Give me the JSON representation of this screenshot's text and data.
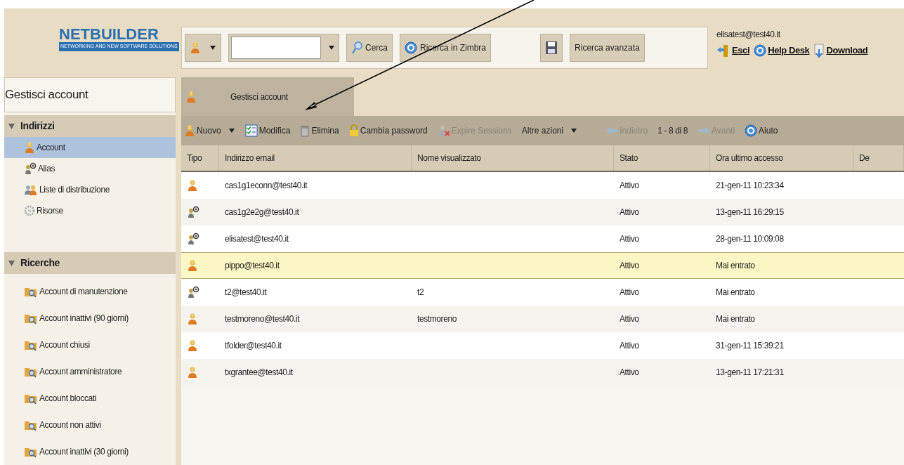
{
  "logo": {
    "name": "NETBUILDER",
    "tagline": "NETWORKING AND NEW SOFTWARE SOLUTIONS"
  },
  "search_bar": {
    "search_button": "Cerca",
    "zimbra_button": "Ricerca in Zimbra",
    "advanced_button": "Ricerca avanzata"
  },
  "user": {
    "email": "elisatest@test40.it",
    "links": [
      {
        "kind": "exit",
        "label": "Esci"
      },
      {
        "kind": "help",
        "label": "Help Desk"
      },
      {
        "kind": "download",
        "label": "Download"
      }
    ]
  },
  "sidebar": {
    "title": "Gestisci account",
    "sections": [
      {
        "label": "Indirizzi",
        "expanded": true,
        "items": [
          {
            "kind": "account",
            "label": "Account",
            "selected": true
          },
          {
            "kind": "alias",
            "label": "Alias",
            "selected": false
          },
          {
            "kind": "list",
            "label": "Liste di distribuzione",
            "selected": false
          },
          {
            "kind": "resource",
            "label": "Risorse",
            "selected": false
          }
        ]
      },
      {
        "label": "Ricerche",
        "expanded": true,
        "items": [
          {
            "kind": "search",
            "label": "Account di manutenzione",
            "selected": false
          },
          {
            "kind": "search",
            "label": "Account inattivi (90 giorni)",
            "selected": false
          },
          {
            "kind": "search",
            "label": "Account chiusi",
            "selected": false
          },
          {
            "kind": "search",
            "label": "Account amministratore",
            "selected": false
          },
          {
            "kind": "search",
            "label": "Account bloccati",
            "selected": false
          },
          {
            "kind": "search",
            "label": "Account non attivi",
            "selected": false
          },
          {
            "kind": "search",
            "label": "Account inattivi (30 giorni)",
            "selected": false
          }
        ]
      }
    ]
  },
  "tabs": [
    {
      "label": "Gestisci account",
      "selected": true
    }
  ],
  "toolbar": [
    {
      "kind": "new",
      "label": "Nuovo",
      "dropdown": true,
      "disabled": false
    },
    {
      "kind": "edit",
      "label": "Modifica",
      "dropdown": false,
      "disabled": false
    },
    {
      "kind": "delete",
      "label": "Elimina",
      "dropdown": false,
      "disabled": false
    },
    {
      "kind": "password",
      "label": "Cambia password",
      "dropdown": false,
      "disabled": false
    },
    {
      "kind": "expire",
      "label": "Expire Sessions",
      "dropdown": false,
      "disabled": true
    },
    {
      "kind": "more",
      "label": "Altre azioni",
      "dropdown": true,
      "disabled": false
    },
    {
      "kind": "back",
      "label": "Indietro",
      "dropdown": false,
      "disabled": true
    },
    {
      "kind": "count",
      "label": "1 - 8 di 8",
      "dropdown": false,
      "disabled": false
    },
    {
      "kind": "forward",
      "label": "Avanti",
      "dropdown": false,
      "disabled": true
    },
    {
      "kind": "help",
      "label": "Aiuto",
      "dropdown": false,
      "disabled": false
    }
  ],
  "table": {
    "columns": [
      "Tipo",
      "Indirizzo email",
      "Nome visualizzato",
      "Stato",
      "Ora ultimo accesso",
      "De"
    ],
    "rows": [
      {
        "kind": "account",
        "email": "cas1g1econn@test40.it",
        "display_name": "",
        "status": "Attivo",
        "last_access": "21-gen-11 10:23:34",
        "selected": false
      },
      {
        "kind": "alias",
        "email": "cas1g2e2g@test40.it",
        "display_name": "",
        "status": "Attivo",
        "last_access": "13-gen-11 16:29:15",
        "selected": false
      },
      {
        "kind": "alias",
        "email": "elisatest@test40.it",
        "display_name": "",
        "status": "Attivo",
        "last_access": "28-gen-11 10:09:08",
        "selected": false
      },
      {
        "kind": "account",
        "email": "pippo@test40.it",
        "display_name": "",
        "status": "Attivo",
        "last_access": "Mai entrato",
        "selected": true
      },
      {
        "kind": "alias",
        "email": "t2@test40.it",
        "display_name": "t2",
        "status": "Attivo",
        "last_access": "Mai entrato",
        "selected": false
      },
      {
        "kind": "account",
        "email": "testmoreno@test40.it",
        "display_name": "testmoreno",
        "status": "Attivo",
        "last_access": "Mai entrato",
        "selected": false
      },
      {
        "kind": "account",
        "email": "tfolder@test40.it",
        "display_name": "",
        "status": "Attivo",
        "last_access": "31-gen-11 15:39:21",
        "selected": false
      },
      {
        "kind": "account",
        "email": "txgrantee@test40.it",
        "display_name": "",
        "status": "Attivo",
        "last_access": "13-gen-11 17:21:31",
        "selected": false
      }
    ]
  }
}
